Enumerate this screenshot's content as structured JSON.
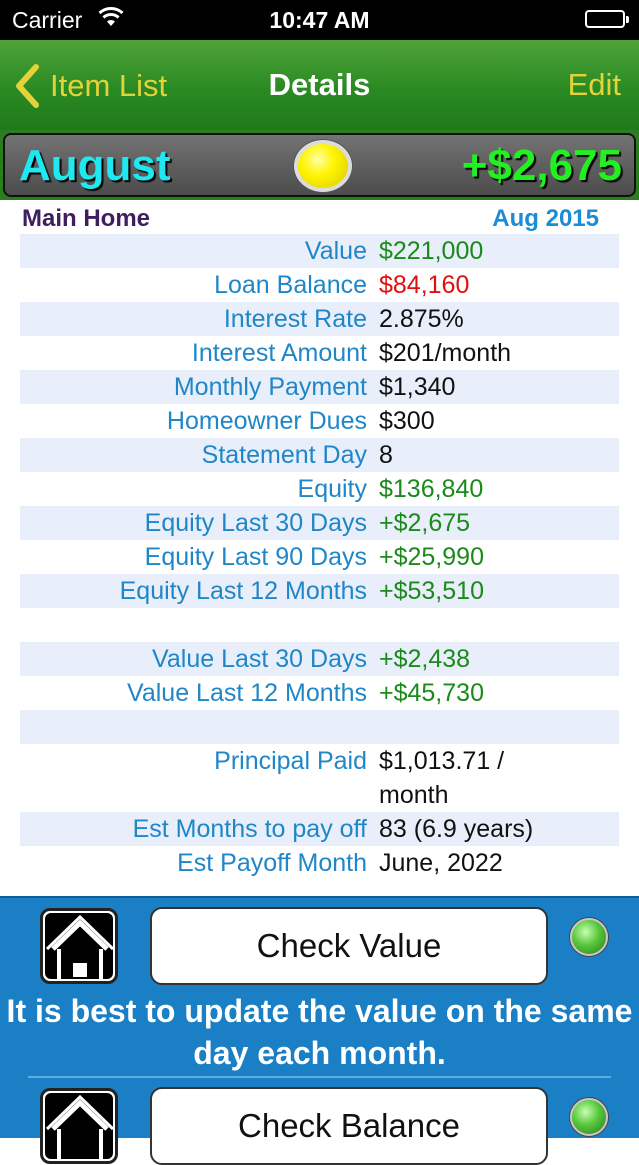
{
  "status_bar": {
    "carrier": "Carrier",
    "time": "10:47 AM"
  },
  "nav": {
    "back_label": "Item List",
    "title": "Details",
    "edit_label": "Edit"
  },
  "month_bar": {
    "month": "August",
    "change": "+$2,675"
  },
  "item": {
    "name": "Main Home",
    "date": "Aug 2015"
  },
  "rows": [
    {
      "label": "Value",
      "value": "$221,000"
    },
    {
      "label": "Loan Balance",
      "value": "$84,160"
    },
    {
      "label": "Interest Rate",
      "value": "2.875%"
    },
    {
      "label": "Interest Amount",
      "value": "$201/month"
    },
    {
      "label": "Monthly Payment",
      "value": "$1,340"
    },
    {
      "label": "Homeowner Dues",
      "value": "$300"
    },
    {
      "label": "Statement Day",
      "value": "8"
    },
    {
      "label": "Equity",
      "value": "$136,840"
    },
    {
      "label": "Equity Last 30 Days",
      "value": "+$2,675"
    },
    {
      "label": "Equity Last 90 Days",
      "value": "+$25,990"
    },
    {
      "label": "Equity Last 12 Months",
      "value": "+$53,510"
    },
    {
      "label": "Value Last 30 Days",
      "value": "+$2,438"
    },
    {
      "label": "Value Last 12 Months",
      "value": "+$45,730"
    },
    {
      "label": "Principal Paid",
      "value": "$1,013.71 /",
      "value2": "month"
    },
    {
      "label": "Est Months to pay off",
      "value": "83 (6.9 years)"
    },
    {
      "label": "Est Payoff Month",
      "value": "June, 2022"
    }
  ],
  "actions": {
    "check_value_label": "Check Value",
    "tip": "It is best to update the value on the same day each month.",
    "check_balance_label": "Check Balance"
  },
  "colors": {
    "nav_green": "#2a8a22",
    "accent_yellow": "#e3d23a",
    "label_blue": "#1f86c8",
    "value_green": "#1a8a1a",
    "value_red": "#e01010",
    "panel_blue": "#1a7fc4",
    "month_cyan": "#20e8f0",
    "change_green": "#22f022"
  },
  "icons": [
    "wifi-icon",
    "battery-icon",
    "chevron-left-icon",
    "status-light-icon",
    "house-icon",
    "led-icon"
  ]
}
